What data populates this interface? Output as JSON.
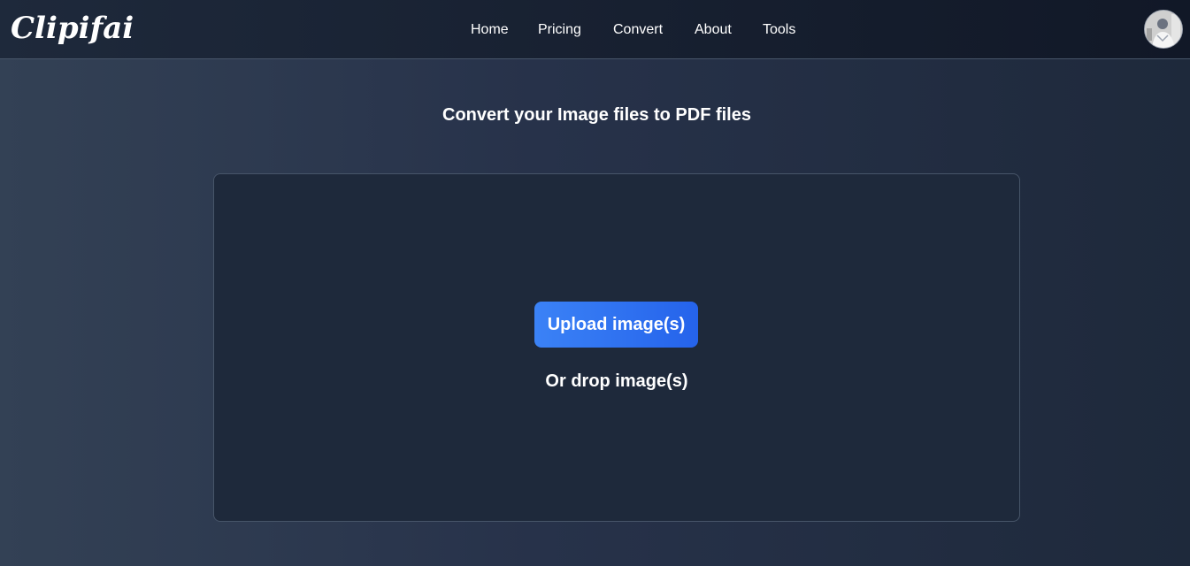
{
  "header": {
    "logo": "Clipifai",
    "nav": [
      {
        "label": "Home"
      },
      {
        "label": "Pricing"
      },
      {
        "label": "Convert"
      },
      {
        "label": "About"
      },
      {
        "label": "Tools"
      }
    ],
    "avatar_icon": "user-avatar-icon"
  },
  "main": {
    "title": "Convert your Image files to PDF files",
    "dropzone": {
      "upload_label": "Upload image(s)",
      "drop_label": "Or drop image(s)"
    }
  },
  "colors": {
    "accent": "#3b82f6",
    "background": "#334155",
    "panel": "#1e293b",
    "header": "#111827"
  }
}
